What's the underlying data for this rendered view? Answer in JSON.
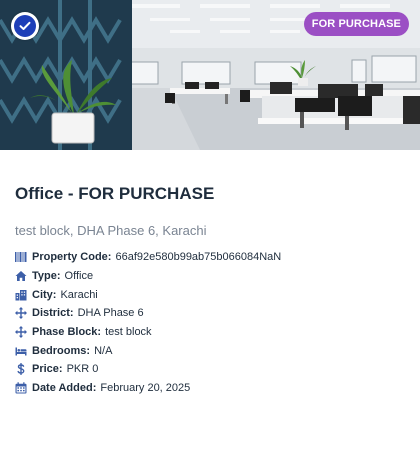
{
  "listing": {
    "badge_label": "FOR PURCHASE",
    "title": "Office - FOR PURCHASE",
    "address": "test block, DHA Phase 6, Karachi"
  },
  "details": [
    {
      "icon": "barcode-icon",
      "label": "Property Code:",
      "value": "66af92e580b99ab75b066084NaN"
    },
    {
      "icon": "home-icon",
      "label": "Type:",
      "value": "Office"
    },
    {
      "icon": "building-icon",
      "label": "City:",
      "value": "Karachi"
    },
    {
      "icon": "arrows-move-icon",
      "label": "District:",
      "value": "DHA Phase 6"
    },
    {
      "icon": "arrows-move-icon",
      "label": "Phase Block:",
      "value": "test block"
    },
    {
      "icon": "bed-icon",
      "label": "Bedrooms:",
      "value": "N/A"
    },
    {
      "icon": "dollar-icon",
      "label": "Price:",
      "value": "PKR 0"
    },
    {
      "icon": "calendar-icon",
      "label": "Date Added:",
      "value": "February 20, 2025"
    }
  ],
  "colors": {
    "badge": "#9b4fc4",
    "verified": "#1e3fb8",
    "icon": "#3d5fa8",
    "text": "#1f2d3d",
    "muted": "#7a8492"
  }
}
